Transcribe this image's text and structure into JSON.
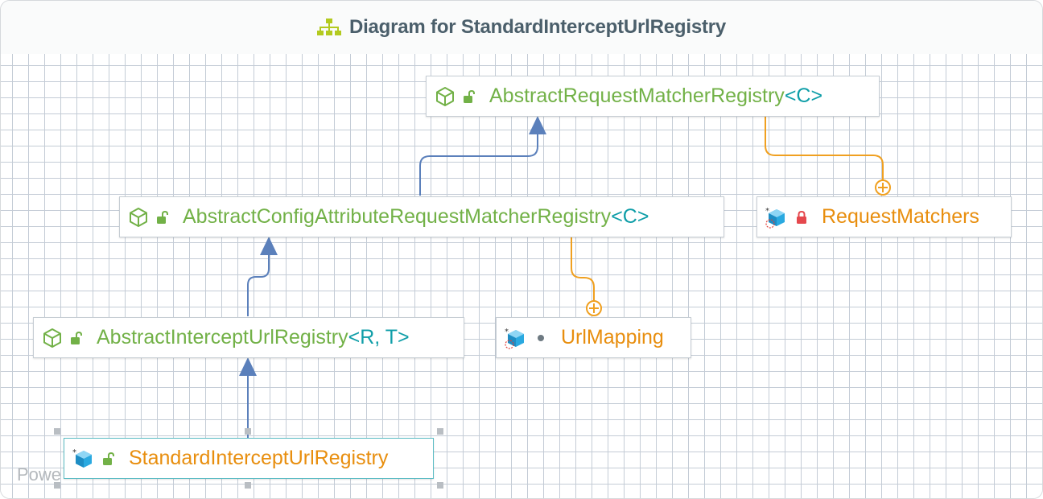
{
  "title": "Diagram for StandardInterceptUrlRegistry",
  "watermark": "Powe",
  "nodes": {
    "abstract_request_matcher_registry": {
      "name": "AbstractRequestMatcherRegistry",
      "type_params": "<C>",
      "kind": "abstract-class",
      "visibility": "public"
    },
    "abstract_config_attribute": {
      "name": "AbstractConfigAttributeRequestMatcherRegistry",
      "type_params": "<C>",
      "kind": "abstract-class",
      "visibility": "public"
    },
    "request_matchers": {
      "name": "RequestMatchers",
      "type_params": "",
      "kind": "static-inner-class",
      "visibility": "private"
    },
    "abstract_intercept_url": {
      "name": "AbstractInterceptUrlRegistry",
      "type_params": "<R, T>",
      "kind": "abstract-class",
      "visibility": "public"
    },
    "url_mapping": {
      "name": "UrlMapping",
      "type_params": "",
      "kind": "static-inner-class",
      "visibility": "package-private"
    },
    "standard_intercept_url": {
      "name": "StandardInterceptUrlRegistry",
      "type_params": "",
      "kind": "inner-class",
      "visibility": "public"
    }
  },
  "colors": {
    "abstract_name": "#72b147",
    "inner_name": "#e88e0e",
    "type_param": "#0f9ea8",
    "inheritance_edge": "#5b80bb",
    "inner_edge": "#f0a020",
    "grid": "#c4ccd6"
  }
}
